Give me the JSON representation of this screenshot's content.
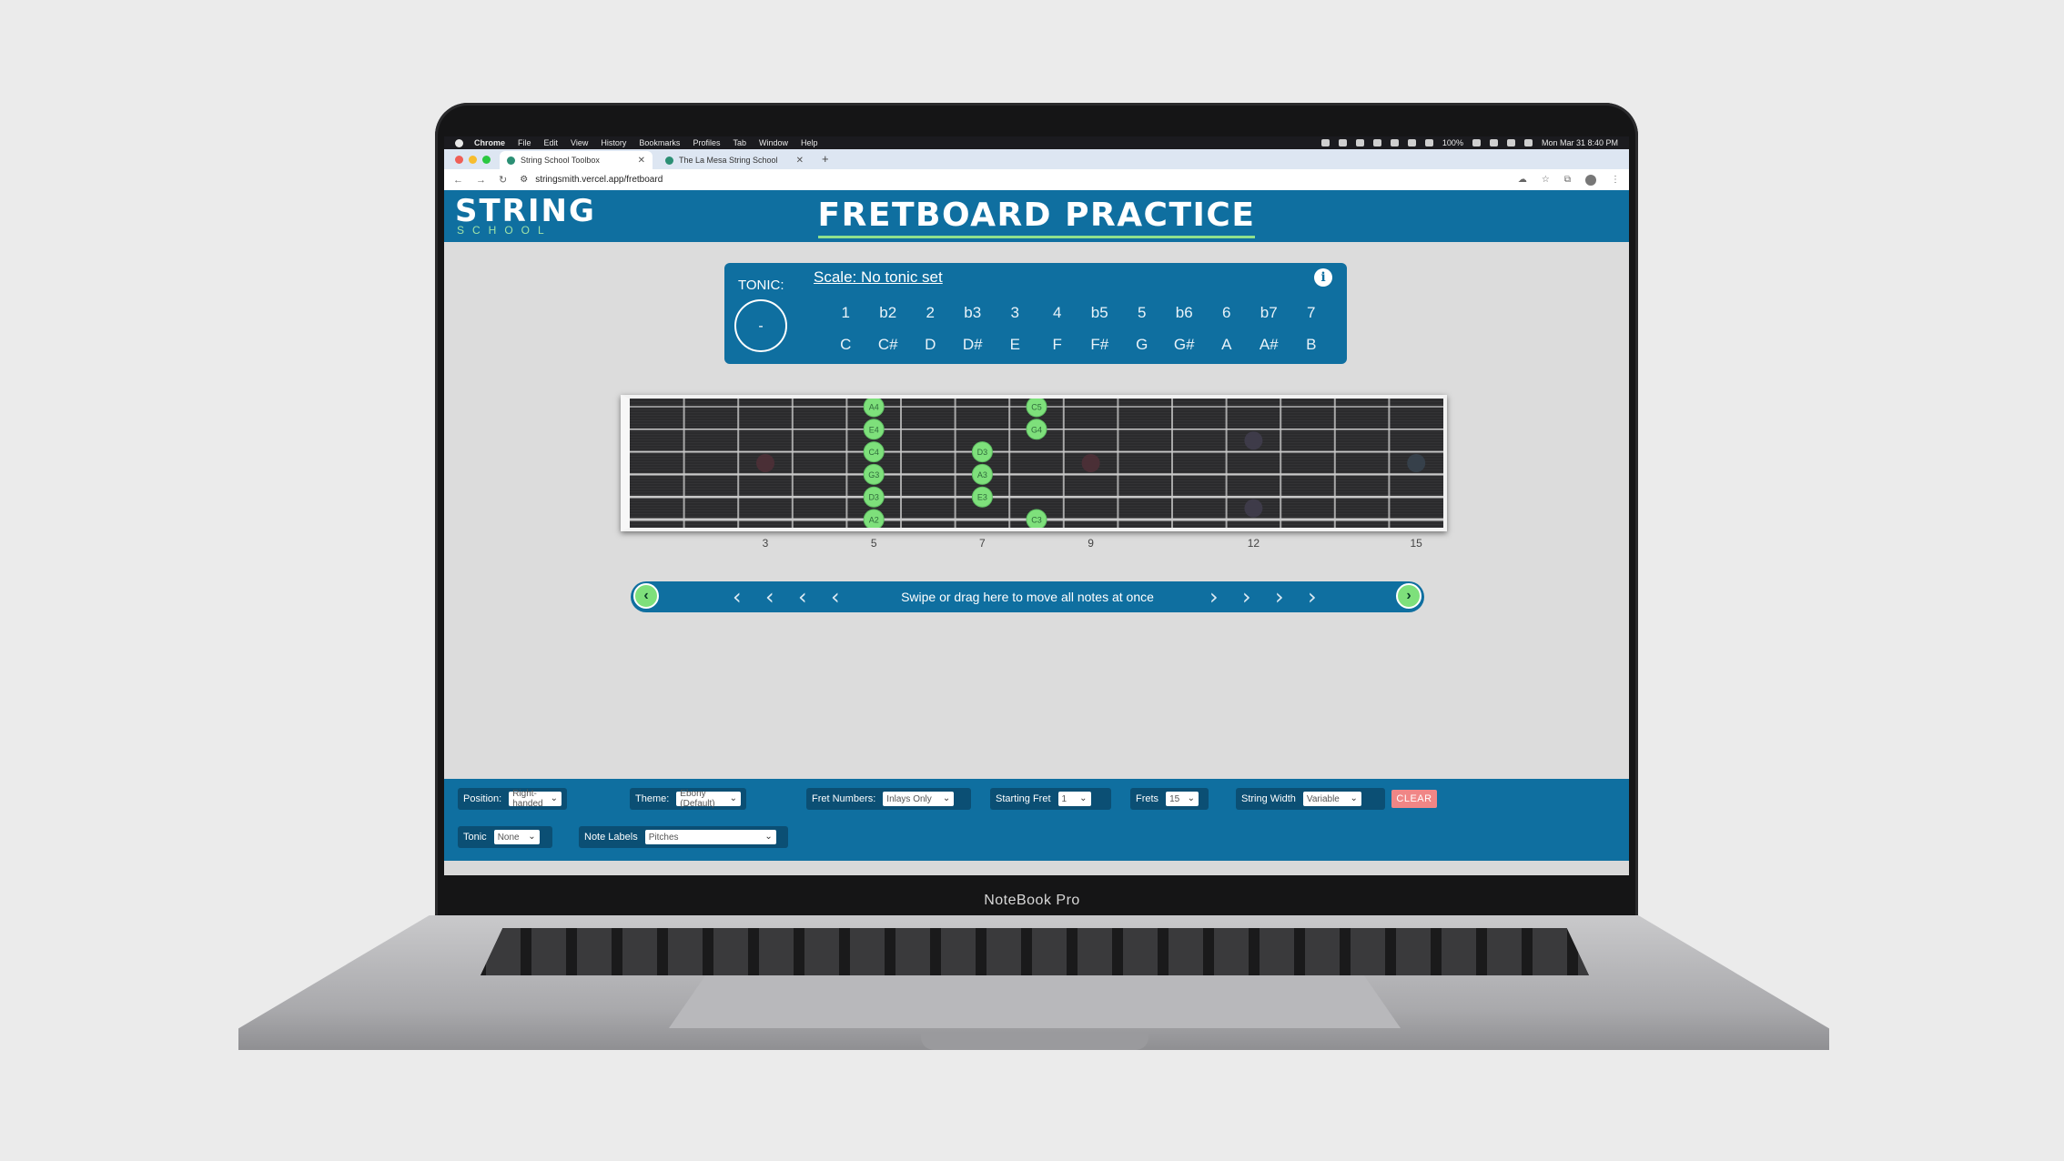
{
  "device": {
    "label": "NoteBook Pro"
  },
  "menubar": {
    "items": [
      "Chrome",
      "File",
      "Edit",
      "View",
      "History",
      "Bookmarks",
      "Profiles",
      "Tab",
      "Window",
      "Help"
    ],
    "battery": "100%",
    "datetime": "Mon Mar 31  8:40 PM"
  },
  "browser": {
    "tabs": [
      {
        "title": "String School Toolbox",
        "active": true
      },
      {
        "title": "The La Mesa String School",
        "active": false
      }
    ],
    "new_tab": "+",
    "url": "stringsmith.vercel.app/fretboard"
  },
  "header": {
    "logo_main": "STRING",
    "logo_sub": "SCHOOL",
    "title": "FRETBOARD PRACTICE"
  },
  "scale_panel": {
    "tonic_label": "TONIC:",
    "tonic_value": "-",
    "scale_link": "Scale: No tonic set",
    "info": "i",
    "degrees": [
      "1",
      "b2",
      "2",
      "b3",
      "3",
      "4",
      "b5",
      "5",
      "b6",
      "6",
      "b7",
      "7"
    ],
    "notes": [
      "C",
      "C#",
      "D",
      "D#",
      "E",
      "F",
      "F#",
      "G",
      "G#",
      "A",
      "A#",
      "B"
    ]
  },
  "fretboard": {
    "frets_total": 15,
    "strings": 6,
    "fret_numbers": [
      "3",
      "5",
      "7",
      "9",
      "12",
      "15"
    ],
    "inlay_frets": [
      3,
      5,
      7,
      9,
      12,
      15
    ],
    "markers": [
      {
        "label": "A4",
        "string": 1,
        "fret": 5
      },
      {
        "label": "E4",
        "string": 2,
        "fret": 5
      },
      {
        "label": "C4",
        "string": 3,
        "fret": 5
      },
      {
        "label": "G3",
        "string": 4,
        "fret": 5
      },
      {
        "label": "D3",
        "string": 5,
        "fret": 5
      },
      {
        "label": "A2",
        "string": 6,
        "fret": 5
      },
      {
        "label": "D3",
        "string": 3,
        "fret": 7
      },
      {
        "label": "A3",
        "string": 4,
        "fret": 7
      },
      {
        "label": "E3",
        "string": 5,
        "fret": 7
      },
      {
        "label": "C5",
        "string": 1,
        "fret": 8
      },
      {
        "label": "G4",
        "string": 2,
        "fret": 8
      },
      {
        "label": "C3",
        "string": 6,
        "fret": 8
      }
    ]
  },
  "swipe": {
    "text": "Swipe or drag here to move all notes at once",
    "left_button": "‹",
    "right_button": "›"
  },
  "controls": {
    "position": {
      "label": "Position:",
      "value": "Right-handed"
    },
    "theme": {
      "label": "Theme:",
      "value": "Ebony (Default)"
    },
    "fret_numbers": {
      "label": "Fret Numbers:",
      "value": "Inlays Only"
    },
    "starting_fret": {
      "label": "Starting Fret",
      "value": "1"
    },
    "frets": {
      "label": "Frets",
      "value": "15"
    },
    "string_width": {
      "label": "String Width",
      "value": "Variable"
    },
    "clear": "CLEAR",
    "tonic": {
      "label": "Tonic",
      "value": "None"
    },
    "note_labels": {
      "label": "Note Labels",
      "value": "Pitches"
    }
  },
  "colors": {
    "brand_blue": "#0f6fa0",
    "note_green": "#7ee07b",
    "clear_red": "#f08686",
    "fretboard_wood": "#2b2b2d"
  }
}
